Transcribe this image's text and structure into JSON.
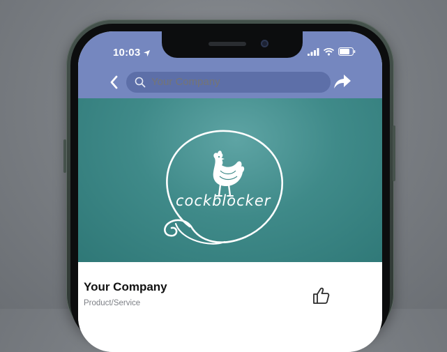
{
  "status_bar": {
    "time": "10:03"
  },
  "nav": {
    "search": {
      "placeholder": "Your Company"
    }
  },
  "cover": {
    "logo_text": "cockblocker"
  },
  "page_info": {
    "name": "Your Company",
    "category": "Product/Service"
  },
  "colors": {
    "navbar": "#7587bf",
    "cover_teal": "#3f8a89",
    "background": "#7c8085"
  },
  "icons": [
    "location-arrow-icon",
    "signal-icon",
    "wifi-icon",
    "battery-icon",
    "back-chevron-icon",
    "search-icon",
    "share-icon",
    "rooster-icon",
    "thumbs-up-icon"
  ]
}
